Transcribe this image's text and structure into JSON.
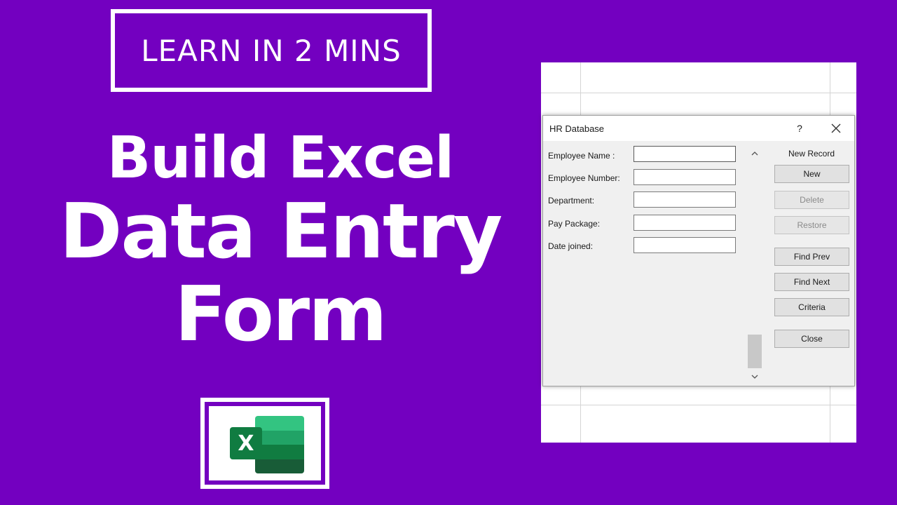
{
  "banner": {
    "learn": "LEARN IN 2 MINS",
    "line1": "Build Excel",
    "line2": "Data Entry",
    "line3": "Form",
    "logo_icon": "excel-logo-icon",
    "logo_letter": "X"
  },
  "colors": {
    "background": "#7300c0",
    "excel_green": "#107c41"
  },
  "dialog": {
    "title": "HR Database",
    "help": "?",
    "close_icon": "close-icon",
    "fields": [
      {
        "label": "Employee Name :",
        "value": ""
      },
      {
        "label": "Employee Number:",
        "value": ""
      },
      {
        "label": "Department:",
        "value": ""
      },
      {
        "label": "Pay Package:",
        "value": ""
      },
      {
        "label": "Date joined:",
        "value": ""
      }
    ],
    "record_status": "New Record",
    "buttons": {
      "new": "New",
      "delete": "Delete",
      "restore": "Restore",
      "find_prev": "Find Prev",
      "find_next": "Find Next",
      "criteria": "Criteria",
      "close": "Close"
    },
    "disabled_buttons": [
      "Delete",
      "Restore"
    ]
  }
}
